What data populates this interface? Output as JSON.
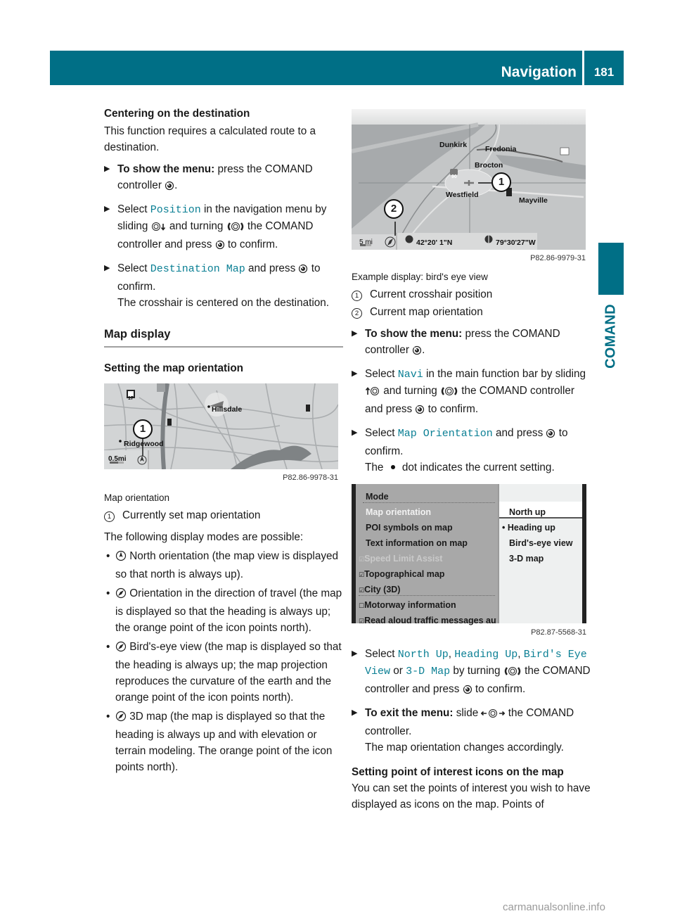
{
  "header": {
    "section": "Navigation",
    "page": "181",
    "side_tab": "COMAND"
  },
  "left": {
    "centering": {
      "title": "Centering on the destination",
      "intro": "This function requires a calculated route to a destination.",
      "step1": {
        "bold": "To show the menu:",
        "text": " press the COMAND controller",
        "end": "."
      },
      "step2": {
        "pre": "Select ",
        "code": "Position",
        "mid": " in the navigation menu by sliding ",
        "mid2": " and turning ",
        "mid3": " the COMAND controller and press ",
        "end": " to confirm."
      },
      "step3": {
        "pre": "Select ",
        "code": "Destination Map",
        "mid": " and press ",
        "end": " to confirm.",
        "result": "The crosshair is centered on the destination."
      }
    },
    "map_display": "Map display",
    "orientation": {
      "title": "Setting the map orientation",
      "figure": {
        "labels": [
          "Hillsdale",
          "Ridgewood"
        ],
        "route_shield": "17",
        "scale": "0.5mi",
        "callout": "1",
        "code": "P82.86-9978-31"
      },
      "caption": "Map orientation",
      "legend": [
        {
          "num": "1",
          "text": "Currently set map orientation"
        }
      ],
      "intro": "The following display modes are possible:",
      "modes": [
        {
          "icon": "north-arrow-icon",
          "text": " North orientation (the map view is displayed so that north is always up)."
        },
        {
          "icon": "compass-icon",
          "text": " Orientation in the direction of travel (the map is displayed so that the heading is always up; the orange point of the icon points north)."
        },
        {
          "icon": "compass-icon",
          "text": " Bird's-eye view (the map is displayed so that the heading is always up; the map projection reproduces the curvature of the earth and the orange point of the icon points north)."
        },
        {
          "icon": "compass-icon",
          "text": " 3D map (the map is displayed so that the heading is always up and with elevation or terrain modeling. The orange point of the icon points north)."
        }
      ]
    }
  },
  "right": {
    "figure": {
      "labels": [
        "Dunkirk",
        "Fredonia",
        "Brocton",
        "Westfield",
        "Mayville"
      ],
      "route_shield": "90",
      "scale": "5 mi",
      "latitude": "42°20' 1\"N",
      "longitude": "79°30'27\"W",
      "callouts": [
        "1",
        "2"
      ],
      "code": "P82.86-9979-31"
    },
    "caption": "Example display: bird's eye view",
    "legend": [
      {
        "num": "1",
        "text": "Current crosshair position"
      },
      {
        "num": "2",
        "text": "Current map orientation"
      }
    ],
    "step1": {
      "bold": "To show the menu:",
      "text": " press the COMAND controller",
      "end": "."
    },
    "step2": {
      "pre": "Select ",
      "code": "Navi",
      "mid": " in the main function bar by sliding ",
      "mid2": " and turning ",
      "mid3": " the COMAND controller and press ",
      "end": " to confirm."
    },
    "step3": {
      "pre": "Select ",
      "code": "Map Orientation",
      "mid": " and press ",
      "end": " to confirm.",
      "result_pre": "The ",
      "result_post": " dot indicates the current setting."
    },
    "menu": {
      "left_items": [
        {
          "label": "Mode",
          "checkbox": ""
        },
        {
          "label": "Map orientation",
          "checkbox": "",
          "selected": true
        },
        {
          "label": "POI symbols on map",
          "checkbox": ""
        },
        {
          "label": "Text information on map",
          "checkbox": ""
        },
        {
          "label": "Speed Limit Assist",
          "checkbox": "checked",
          "disabled": true
        },
        {
          "label": "Topographical map",
          "checkbox": "checked"
        },
        {
          "label": "City (3D)",
          "checkbox": "checked"
        },
        {
          "label": "Motorway information",
          "checkbox": "unchecked"
        },
        {
          "label": "Read aloud traffic messages aut",
          "checkbox": "checked"
        }
      ],
      "right_items": [
        {
          "label": "North up",
          "highlighted": true,
          "current": false
        },
        {
          "label": "Heading up",
          "highlighted": false,
          "current": true
        },
        {
          "label": "Bird's-eye view",
          "highlighted": false,
          "current": false
        },
        {
          "label": "3-D map",
          "highlighted": false,
          "current": false
        }
      ],
      "code": "P82.87-5568-31"
    },
    "step4": {
      "pre": "Select ",
      "codes": [
        "North Up",
        "Heading Up",
        "Bird's Eye View",
        "3-D Map"
      ],
      "sep1": ", ",
      "sep2": ", ",
      "sep3": " or ",
      "mid": " by turning ",
      "mid2": " the COMAND controller and press ",
      "end": " to confirm."
    },
    "step5": {
      "bold": "To exit the menu:",
      "text": " slide ",
      "text2": " the COMAND controller.",
      "result": "The map orientation changes accordingly."
    },
    "poi": {
      "title": "Setting point of interest icons on the map",
      "text": "You can set the points of interest you wish to have displayed as icons on the map. Points of"
    }
  },
  "watermark": "carmanualsonline.info"
}
